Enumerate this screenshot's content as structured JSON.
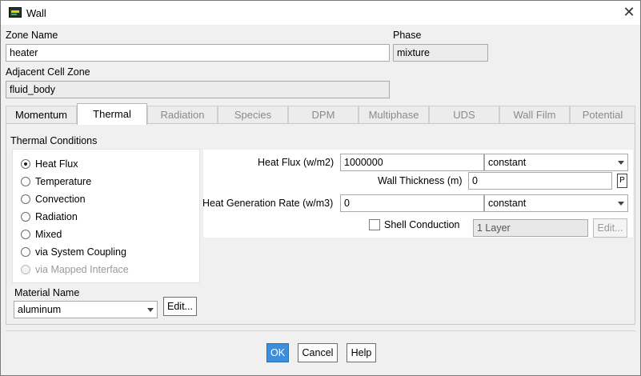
{
  "window": {
    "title": "Wall"
  },
  "zone": {
    "name_label": "Zone Name",
    "name_value": "heater",
    "phase_label": "Phase",
    "phase_value": "mixture"
  },
  "adjacent": {
    "label": "Adjacent Cell Zone",
    "value": "fluid_body"
  },
  "tabs": [
    {
      "label": "Momentum"
    },
    {
      "label": "Thermal"
    },
    {
      "label": "Radiation"
    },
    {
      "label": "Species"
    },
    {
      "label": "DPM"
    },
    {
      "label": "Multiphase"
    },
    {
      "label": "UDS"
    },
    {
      "label": "Wall Film"
    },
    {
      "label": "Potential"
    }
  ],
  "thermal": {
    "conditions_label": "Thermal Conditions",
    "options": [
      {
        "label": "Heat Flux"
      },
      {
        "label": "Temperature"
      },
      {
        "label": "Convection"
      },
      {
        "label": "Radiation"
      },
      {
        "label": "Mixed"
      },
      {
        "label": "via System Coupling"
      },
      {
        "label": "via Mapped Interface"
      }
    ],
    "material_label": "Material Name",
    "material_value": "aluminum",
    "material_edit": "Edit...",
    "heat_flux_label": "Heat Flux (w/m2)",
    "heat_flux_value": "1000000",
    "heat_flux_method": "constant",
    "wall_thickness_label": "Wall Thickness (m)",
    "wall_thickness_value": "0",
    "param_button": "P",
    "heat_gen_label": "Heat Generation Rate (w/m3)",
    "heat_gen_value": "0",
    "heat_gen_method": "constant",
    "shell_label": "Shell Conduction",
    "layers_value": "1 Layer",
    "layers_edit": "Edit..."
  },
  "footer": {
    "ok": "OK",
    "cancel": "Cancel",
    "help": "Help"
  },
  "colors": {
    "accent": "#3b8fdd"
  }
}
